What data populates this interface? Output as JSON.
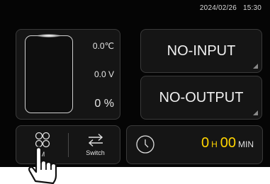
{
  "status_bar": {
    "date": "2024/02/26",
    "time": "15:30"
  },
  "battery_readings": {
    "temperature": "0.0℃",
    "voltage": "0.0 V",
    "percent": "0 %"
  },
  "input_button": {
    "label": "NO-INPUT"
  },
  "output_button": {
    "label": "NO-OUTPUT"
  },
  "nav": {
    "menu": {
      "label": "M",
      "icon": "grid-menu-icon"
    },
    "switch": {
      "label": "Switch",
      "icon": "swap-arrows-icon"
    }
  },
  "timer": {
    "icon": "clock-icon",
    "hours": "0",
    "hour_unit": "H",
    "minutes": "00",
    "minute_unit": "MIN"
  },
  "colors": {
    "background": "#050505",
    "panel": "#151515",
    "accent": "#ffd400"
  }
}
